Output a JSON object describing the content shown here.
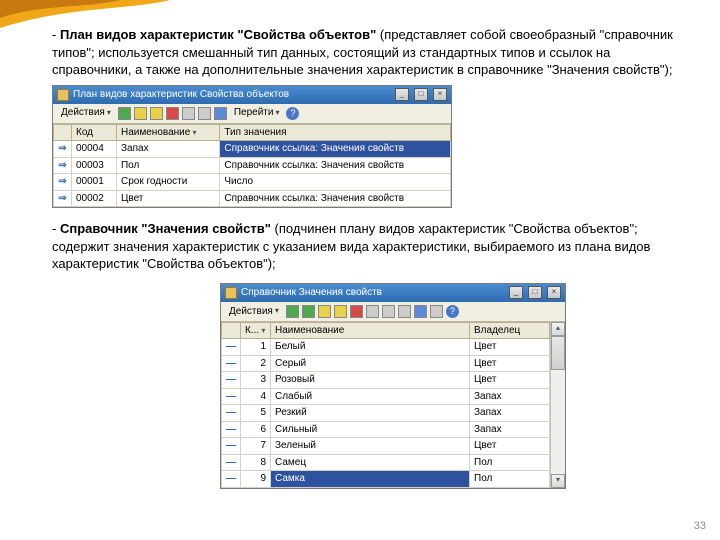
{
  "page_number": "33",
  "para1": {
    "lead": "План видов характеристик \"Свойства объектов\"",
    "rest": " (представляет собой своеобразный \"справочник типов\"; используется смешанный тип данных, состоящий из стандартных типов и ссылок на справочники, а также на дополнительные значения характеристик в справочнике \"Значения свойств\");"
  },
  "para2": {
    "lead": "Справочник \"Значения свойств\"",
    "rest": " (подчинен плану видов характеристик \"Свойства объектов\"; содержит значения характеристик с указанием вида характеристики, выбираемого из плана видов характеристик \"Свойства объектов\");"
  },
  "win1": {
    "title": "План видов характеристик Свойства объектов",
    "toolbar": {
      "actions": "Действия",
      "goto": "Перейти"
    },
    "cols": {
      "c1": "Код",
      "c2": "Наименование",
      "c3": "Тип значения"
    },
    "rows": [
      {
        "code": "00004",
        "name": "Запах",
        "type": "Справочник ссылка: Значения свойств",
        "sel": true
      },
      {
        "code": "00003",
        "name": "Пол",
        "type": "Справочник ссылка: Значения свойств",
        "sel": false
      },
      {
        "code": "00001",
        "name": "Срок годности",
        "type": "Число",
        "sel": false
      },
      {
        "code": "00002",
        "name": "Цвет",
        "type": "Справочник ссылка: Значения свойств",
        "sel": false
      }
    ],
    "rowmark": "⇒"
  },
  "win2": {
    "title": "Справочник Значения свойств",
    "toolbar": {
      "actions": "Действия"
    },
    "cols": {
      "c1": "К...",
      "c2": "Наименование",
      "c3": "Владелец"
    },
    "rows": [
      {
        "k": "1",
        "name": "Белый",
        "owner": "Цвет"
      },
      {
        "k": "2",
        "name": "Серый",
        "owner": "Цвет"
      },
      {
        "k": "3",
        "name": "Розовый",
        "owner": "Цвет"
      },
      {
        "k": "4",
        "name": "Слабый",
        "owner": "Запах"
      },
      {
        "k": "5",
        "name": "Резкий",
        "owner": "Запах"
      },
      {
        "k": "6",
        "name": "Сильный",
        "owner": "Запах"
      },
      {
        "k": "7",
        "name": "Зеленый",
        "owner": "Цвет"
      },
      {
        "k": "8",
        "name": "Самец",
        "owner": "Пол"
      },
      {
        "k": "9",
        "name": "Самка",
        "owner": "Пол",
        "sel": true
      }
    ],
    "rowmark": "—"
  }
}
